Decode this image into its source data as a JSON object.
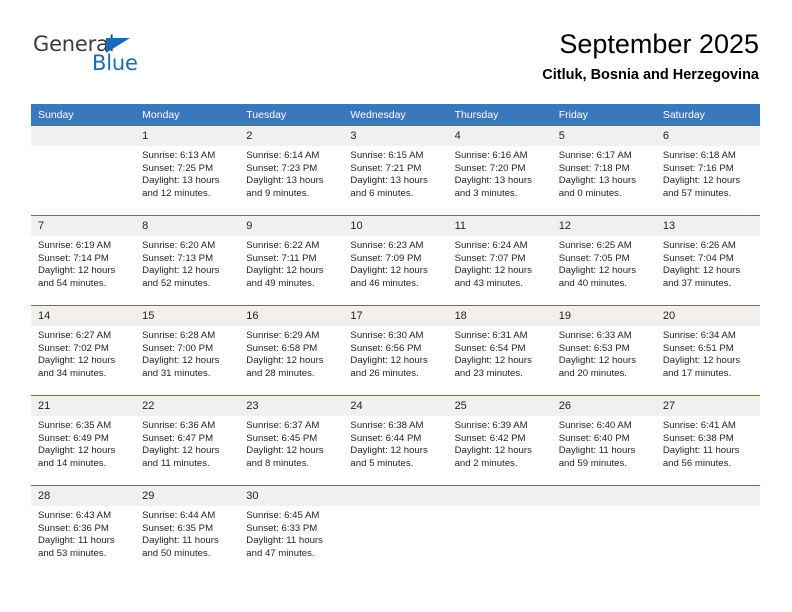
{
  "brand": {
    "name_top": "General",
    "name_bottom": "Blue",
    "triangle_color": "#1a6bb5",
    "text_color": "#3c3c3b"
  },
  "header": {
    "title": "September 2025",
    "subtitle": "Citluk, Bosnia and Herzegovina"
  },
  "theme": {
    "header_blue": "#3b77bd",
    "daynum_band": "#f0f0f0",
    "cell_background": "#ffffff",
    "text": "#231f20"
  },
  "weekday_headers": [
    "Sunday",
    "Monday",
    "Tuesday",
    "Wednesday",
    "Thursday",
    "Friday",
    "Saturday"
  ],
  "weeks": [
    [
      {
        "day": "",
        "sunrise": "",
        "sunset": "",
        "daylight_line1": "",
        "daylight_line2": ""
      },
      {
        "day": "1",
        "sunrise": "Sunrise: 6:13 AM",
        "sunset": "Sunset: 7:25 PM",
        "daylight_line1": "Daylight: 13 hours",
        "daylight_line2": "and 12 minutes."
      },
      {
        "day": "2",
        "sunrise": "Sunrise: 6:14 AM",
        "sunset": "Sunset: 7:23 PM",
        "daylight_line1": "Daylight: 13 hours",
        "daylight_line2": "and 9 minutes."
      },
      {
        "day": "3",
        "sunrise": "Sunrise: 6:15 AM",
        "sunset": "Sunset: 7:21 PM",
        "daylight_line1": "Daylight: 13 hours",
        "daylight_line2": "and 6 minutes."
      },
      {
        "day": "4",
        "sunrise": "Sunrise: 6:16 AM",
        "sunset": "Sunset: 7:20 PM",
        "daylight_line1": "Daylight: 13 hours",
        "daylight_line2": "and 3 minutes."
      },
      {
        "day": "5",
        "sunrise": "Sunrise: 6:17 AM",
        "sunset": "Sunset: 7:18 PM",
        "daylight_line1": "Daylight: 13 hours",
        "daylight_line2": "and 0 minutes."
      },
      {
        "day": "6",
        "sunrise": "Sunrise: 6:18 AM",
        "sunset": "Sunset: 7:16 PM",
        "daylight_line1": "Daylight: 12 hours",
        "daylight_line2": "and 57 minutes."
      }
    ],
    [
      {
        "day": "7",
        "sunrise": "Sunrise: 6:19 AM",
        "sunset": "Sunset: 7:14 PM",
        "daylight_line1": "Daylight: 12 hours",
        "daylight_line2": "and 54 minutes."
      },
      {
        "day": "8",
        "sunrise": "Sunrise: 6:20 AM",
        "sunset": "Sunset: 7:13 PM",
        "daylight_line1": "Daylight: 12 hours",
        "daylight_line2": "and 52 minutes."
      },
      {
        "day": "9",
        "sunrise": "Sunrise: 6:22 AM",
        "sunset": "Sunset: 7:11 PM",
        "daylight_line1": "Daylight: 12 hours",
        "daylight_line2": "and 49 minutes."
      },
      {
        "day": "10",
        "sunrise": "Sunrise: 6:23 AM",
        "sunset": "Sunset: 7:09 PM",
        "daylight_line1": "Daylight: 12 hours",
        "daylight_line2": "and 46 minutes."
      },
      {
        "day": "11",
        "sunrise": "Sunrise: 6:24 AM",
        "sunset": "Sunset: 7:07 PM",
        "daylight_line1": "Daylight: 12 hours",
        "daylight_line2": "and 43 minutes."
      },
      {
        "day": "12",
        "sunrise": "Sunrise: 6:25 AM",
        "sunset": "Sunset: 7:05 PM",
        "daylight_line1": "Daylight: 12 hours",
        "daylight_line2": "and 40 minutes."
      },
      {
        "day": "13",
        "sunrise": "Sunrise: 6:26 AM",
        "sunset": "Sunset: 7:04 PM",
        "daylight_line1": "Daylight: 12 hours",
        "daylight_line2": "and 37 minutes."
      }
    ],
    [
      {
        "day": "14",
        "sunrise": "Sunrise: 6:27 AM",
        "sunset": "Sunset: 7:02 PM",
        "daylight_line1": "Daylight: 12 hours",
        "daylight_line2": "and 34 minutes."
      },
      {
        "day": "15",
        "sunrise": "Sunrise: 6:28 AM",
        "sunset": "Sunset: 7:00 PM",
        "daylight_line1": "Daylight: 12 hours",
        "daylight_line2": "and 31 minutes."
      },
      {
        "day": "16",
        "sunrise": "Sunrise: 6:29 AM",
        "sunset": "Sunset: 6:58 PM",
        "daylight_line1": "Daylight: 12 hours",
        "daylight_line2": "and 28 minutes."
      },
      {
        "day": "17",
        "sunrise": "Sunrise: 6:30 AM",
        "sunset": "Sunset: 6:56 PM",
        "daylight_line1": "Daylight: 12 hours",
        "daylight_line2": "and 26 minutes."
      },
      {
        "day": "18",
        "sunrise": "Sunrise: 6:31 AM",
        "sunset": "Sunset: 6:54 PM",
        "daylight_line1": "Daylight: 12 hours",
        "daylight_line2": "and 23 minutes."
      },
      {
        "day": "19",
        "sunrise": "Sunrise: 6:33 AM",
        "sunset": "Sunset: 6:53 PM",
        "daylight_line1": "Daylight: 12 hours",
        "daylight_line2": "and 20 minutes."
      },
      {
        "day": "20",
        "sunrise": "Sunrise: 6:34 AM",
        "sunset": "Sunset: 6:51 PM",
        "daylight_line1": "Daylight: 12 hours",
        "daylight_line2": "and 17 minutes."
      }
    ],
    [
      {
        "day": "21",
        "sunrise": "Sunrise: 6:35 AM",
        "sunset": "Sunset: 6:49 PM",
        "daylight_line1": "Daylight: 12 hours",
        "daylight_line2": "and 14 minutes."
      },
      {
        "day": "22",
        "sunrise": "Sunrise: 6:36 AM",
        "sunset": "Sunset: 6:47 PM",
        "daylight_line1": "Daylight: 12 hours",
        "daylight_line2": "and 11 minutes."
      },
      {
        "day": "23",
        "sunrise": "Sunrise: 6:37 AM",
        "sunset": "Sunset: 6:45 PM",
        "daylight_line1": "Daylight: 12 hours",
        "daylight_line2": "and 8 minutes."
      },
      {
        "day": "24",
        "sunrise": "Sunrise: 6:38 AM",
        "sunset": "Sunset: 6:44 PM",
        "daylight_line1": "Daylight: 12 hours",
        "daylight_line2": "and 5 minutes."
      },
      {
        "day": "25",
        "sunrise": "Sunrise: 6:39 AM",
        "sunset": "Sunset: 6:42 PM",
        "daylight_line1": "Daylight: 12 hours",
        "daylight_line2": "and 2 minutes."
      },
      {
        "day": "26",
        "sunrise": "Sunrise: 6:40 AM",
        "sunset": "Sunset: 6:40 PM",
        "daylight_line1": "Daylight: 11 hours",
        "daylight_line2": "and 59 minutes."
      },
      {
        "day": "27",
        "sunrise": "Sunrise: 6:41 AM",
        "sunset": "Sunset: 6:38 PM",
        "daylight_line1": "Daylight: 11 hours",
        "daylight_line2": "and 56 minutes."
      }
    ],
    [
      {
        "day": "28",
        "sunrise": "Sunrise: 6:43 AM",
        "sunset": "Sunset: 6:36 PM",
        "daylight_line1": "Daylight: 11 hours",
        "daylight_line2": "and 53 minutes."
      },
      {
        "day": "29",
        "sunrise": "Sunrise: 6:44 AM",
        "sunset": "Sunset: 6:35 PM",
        "daylight_line1": "Daylight: 11 hours",
        "daylight_line2": "and 50 minutes."
      },
      {
        "day": "30",
        "sunrise": "Sunrise: 6:45 AM",
        "sunset": "Sunset: 6:33 PM",
        "daylight_line1": "Daylight: 11 hours",
        "daylight_line2": "and 47 minutes."
      },
      {
        "day": "",
        "sunrise": "",
        "sunset": "",
        "daylight_line1": "",
        "daylight_line2": ""
      },
      {
        "day": "",
        "sunrise": "",
        "sunset": "",
        "daylight_line1": "",
        "daylight_line2": ""
      },
      {
        "day": "",
        "sunrise": "",
        "sunset": "",
        "daylight_line1": "",
        "daylight_line2": ""
      },
      {
        "day": "",
        "sunrise": "",
        "sunset": "",
        "daylight_line1": "",
        "daylight_line2": ""
      }
    ]
  ]
}
